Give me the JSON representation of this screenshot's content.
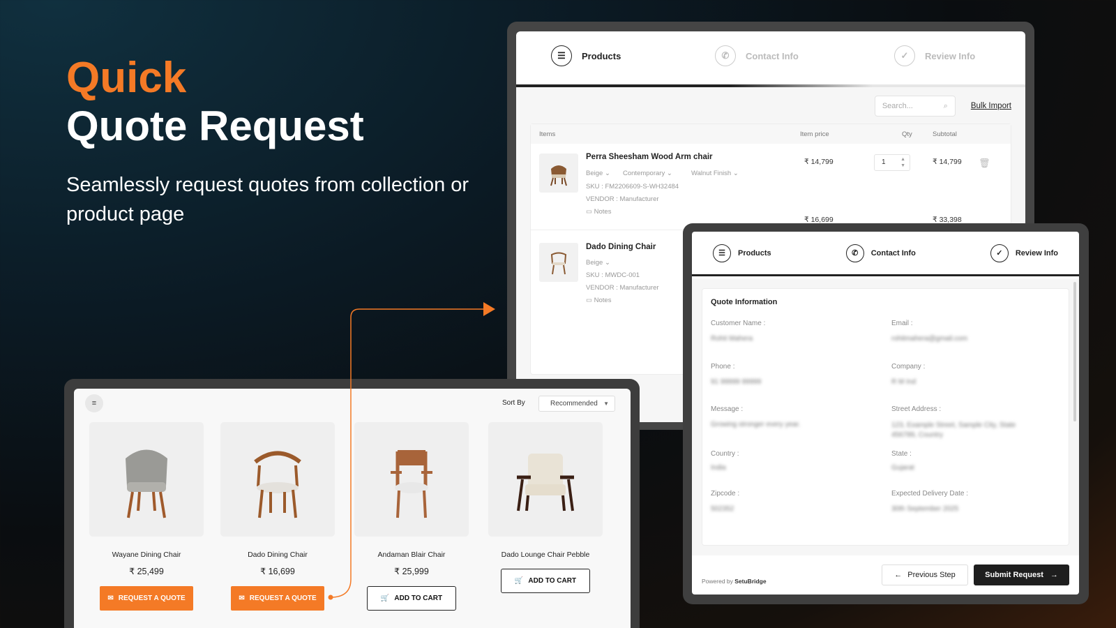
{
  "hero": {
    "accent": "Quick",
    "title": "Quote Request",
    "subtitle": "Seamlessly request quotes from collection or product page"
  },
  "colors": {
    "accent": "#f47a26",
    "dark": "#1e1e1e",
    "frame": "#454545"
  },
  "cart": {
    "steps": [
      {
        "label": "Products",
        "icon": "list-icon",
        "active": true
      },
      {
        "label": "Contact Info",
        "icon": "phone-icon",
        "active": false
      },
      {
        "label": "Review Info",
        "icon": "check-circle-icon",
        "active": false
      }
    ],
    "search_placeholder": "Search...",
    "bulk_import": "Bulk Import",
    "columns": {
      "items": "Items",
      "price": "Item price",
      "qty": "Qty",
      "subtotal": "Subtotal"
    },
    "rows": [
      {
        "name": "Perra Sheesham Wood Arm chair",
        "variants": [
          "Beige",
          "Contemporary",
          "Walnut Finish"
        ],
        "sku": "SKU : FM2206609-S-WH32484",
        "vendor": "VENDOR : Manufacturer",
        "notes": "Notes",
        "price": "₹ 14,799",
        "qty": "1",
        "subtotal": "₹ 14,799"
      },
      {
        "name": "Dado Dining Chair",
        "variants": [
          "Beige"
        ],
        "sku": "SKU : MWDC-001",
        "vendor": "VENDOR : Manufacturer",
        "notes": "Notes",
        "price": "₹ 16,699",
        "subtotal": "₹ 33,398"
      }
    ]
  },
  "form": {
    "steps": [
      {
        "label": "Products",
        "icon": "list-icon"
      },
      {
        "label": "Contact Info",
        "icon": "phone-icon"
      },
      {
        "label": "Review Info",
        "icon": "check-circle-icon"
      }
    ],
    "title": "Quote Information",
    "fields": {
      "customer_name": {
        "label": "Customer Name :",
        "value": "Rohit Mahera"
      },
      "email": {
        "label": "Email :",
        "value": "rohitmahera@gmail.com"
      },
      "phone": {
        "label": "Phone :",
        "value": "91 99999 99999"
      },
      "company": {
        "label": "Company :",
        "value": "R M Ind"
      },
      "message": {
        "label": "Message :",
        "value": "Growing stronger every year."
      },
      "street": {
        "label": "Street Address :",
        "value": "123, Example Street, Sample City, State 456789, Country"
      },
      "country": {
        "label": "Country :",
        "value": "India"
      },
      "state": {
        "label": "State :",
        "value": "Gujarat"
      },
      "zipcode": {
        "label": "Zipcode :",
        "value": "502352"
      },
      "delivery": {
        "label": "Expected Delivery Date :",
        "value": "30th September 2025"
      }
    },
    "powered_prefix": "Powered by",
    "powered_brand": "SetuBridge",
    "prev_label": "Previous Step",
    "submit_label": "Submit Request"
  },
  "collection": {
    "sort_label": "Sort By",
    "sort_value": "Recommended",
    "products": [
      {
        "name": "Wayane Dining Chair",
        "price": "₹ 25,499",
        "action": "REQUEST A QUOTE"
      },
      {
        "name": "Dado Dining Chair",
        "price": "₹ 16,699",
        "action": "REQUEST A QUOTE"
      },
      {
        "name": "Andaman Blair Chair",
        "price": "₹ 25,999",
        "action": "ADD TO CART"
      },
      {
        "name": "Dado Lounge Chair Pebble",
        "price": "",
        "action": "ADD TO CART"
      }
    ]
  }
}
